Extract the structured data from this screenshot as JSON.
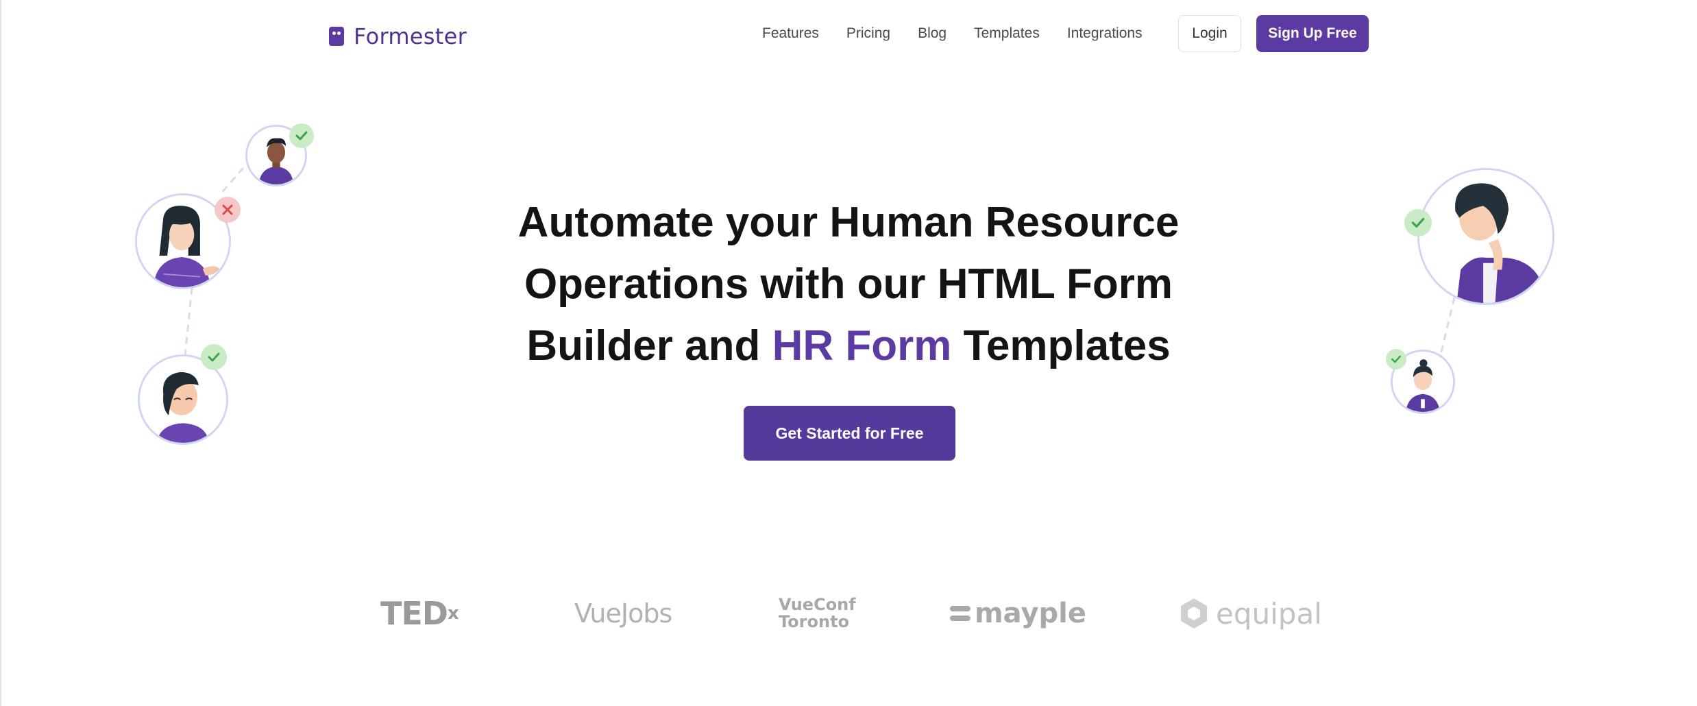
{
  "brand": {
    "name": "Formester"
  },
  "nav": {
    "items": [
      {
        "label": "Features"
      },
      {
        "label": "Pricing"
      },
      {
        "label": "Blog"
      },
      {
        "label": "Templates"
      },
      {
        "label": "Integrations"
      }
    ],
    "login_label": "Login",
    "signup_label": "Sign Up Free"
  },
  "hero": {
    "title_line1": "Automate your Human Resource",
    "title_line2": "Operations with our HTML Form",
    "title_line3_pre": "Builder and ",
    "title_line3_accent": "HR Form",
    "title_line3_post": " Templates",
    "cta_label": "Get Started for Free"
  },
  "logos": {
    "tedx": "TED",
    "tedx_sup": "x",
    "vuejobs": "VueJobs",
    "vueconf_line1": "VueConf",
    "vueconf_line2": "Toronto",
    "mayple": "mayple",
    "equipal": "equipal"
  },
  "colors": {
    "brand": "#5b3ba1",
    "cta": "#553a9b",
    "badge_ok": "#c9ecc6",
    "badge_no": "#f5c8c8",
    "avatar_ring": "#cfd6f2"
  }
}
